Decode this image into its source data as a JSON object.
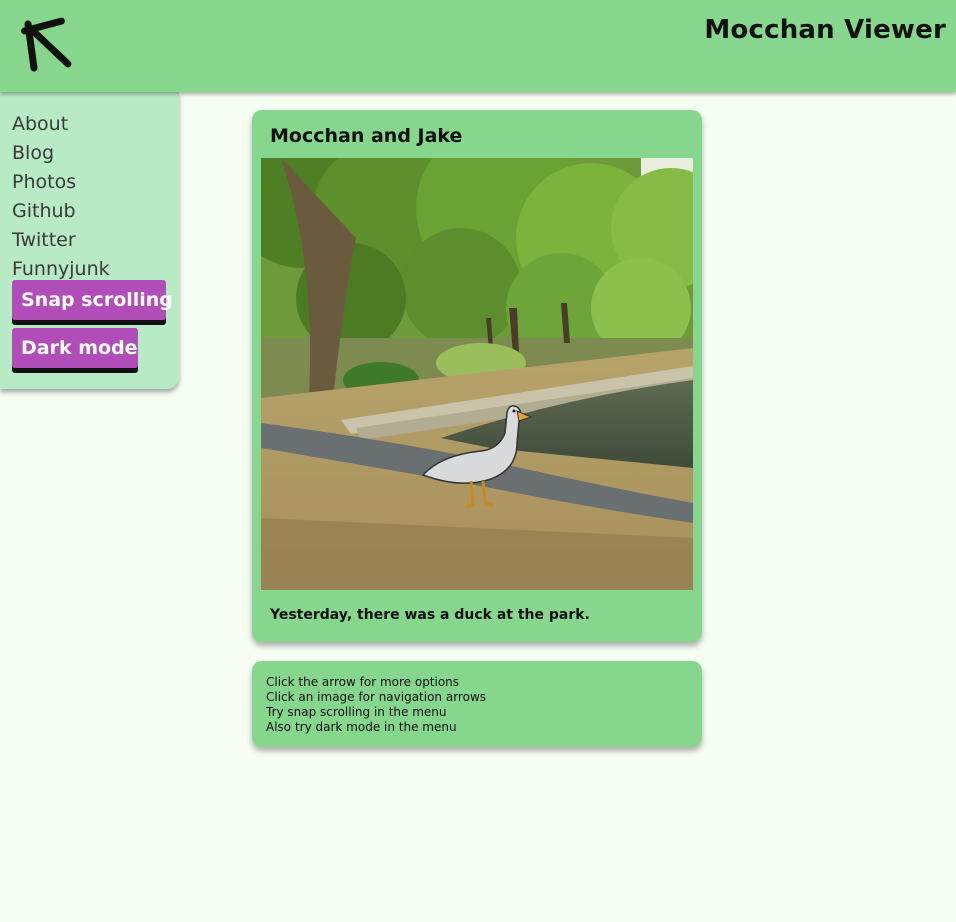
{
  "header": {
    "title": "Mocchan Viewer",
    "back_icon": "arrow-up-left-icon"
  },
  "menu": {
    "links": [
      "About",
      "Blog",
      "Photos",
      "Github",
      "Twitter",
      "Funnyjunk"
    ],
    "snap_button": "Snap scrolling",
    "dark_button": "Dark mode"
  },
  "post": {
    "title": "Mocchan and Jake",
    "image_alt": "duck-in-park-photo",
    "caption": "Yesterday, there was a duck at the park."
  },
  "tips": [
    "Click the arrow for more options",
    "Click an image for navigation arrows",
    "Try snap scrolling in the menu",
    "Also try dark mode in the menu"
  ],
  "colors": {
    "page_background": "#f6fdf3",
    "header_green": "#86d68d",
    "menu_green": "#b8eac6",
    "button_purple": "#b04db8"
  }
}
